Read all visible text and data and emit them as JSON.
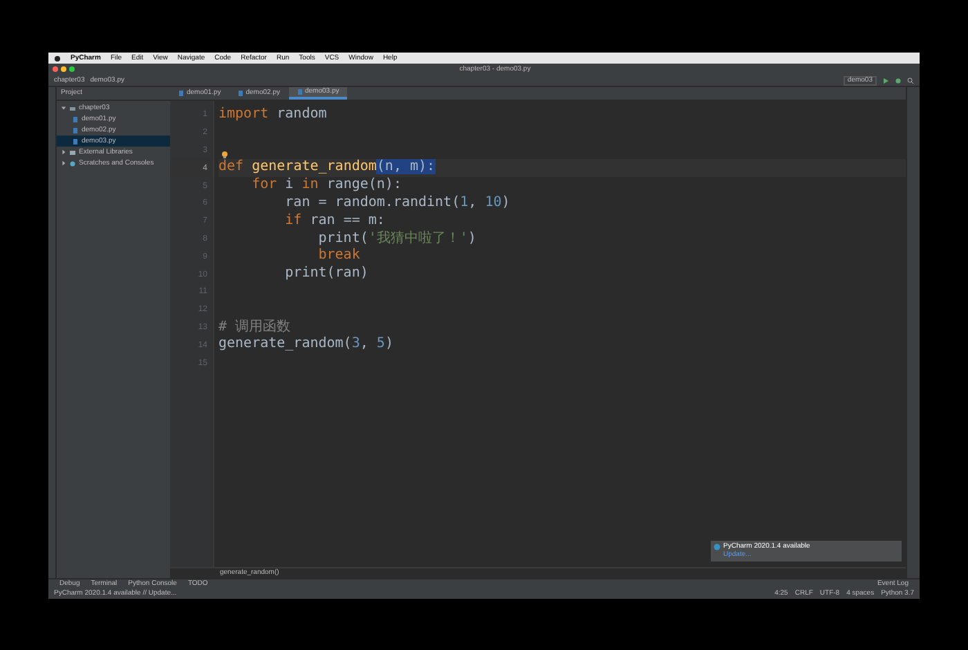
{
  "menu_bar": {
    "items": [
      "PyCharm",
      "File",
      "Edit",
      "View",
      "Navigate",
      "Code",
      "Refactor",
      "Run",
      "Tools",
      "VCS",
      "Window",
      "Help"
    ]
  },
  "window": {
    "title": "chapter03 - demo03.py"
  },
  "nav_bar": {
    "crumbs": [
      "chapter03",
      "demo03.py"
    ],
    "run_config": "demo03"
  },
  "project_panel": {
    "title": "Project",
    "tree": [
      {
        "label": "chapter03",
        "kind": "folder",
        "selected": false,
        "expanded": true,
        "children": [
          {
            "label": "demo01.py",
            "kind": "file",
            "selected": false
          },
          {
            "label": "demo02.py",
            "kind": "file",
            "selected": false
          },
          {
            "label": "demo03.py",
            "kind": "file",
            "selected": true
          }
        ]
      },
      {
        "label": "External Libraries",
        "kind": "library",
        "selected": false,
        "expanded": false
      },
      {
        "label": "Scratches and Consoles",
        "kind": "scratch",
        "selected": false,
        "expanded": false
      }
    ]
  },
  "editor_tabs": [
    {
      "label": "demo01.py",
      "selected": false
    },
    {
      "label": "demo02.py",
      "selected": false
    },
    {
      "label": "demo03.py",
      "selected": true
    }
  ],
  "code_lines": [
    {
      "number": "1",
      "current": false,
      "tokens": [
        {
          "kind": "keyword",
          "text": "import"
        },
        {
          "kind": "plain",
          "text": " random"
        }
      ]
    },
    {
      "number": "2",
      "current": false
    },
    {
      "number": "3",
      "current": false,
      "bulb": true
    },
    {
      "number": "4",
      "current": true,
      "tokens": [
        {
          "kind": "keyword",
          "text": "def "
        },
        {
          "kind": "function",
          "text": "generate_random"
        },
        {
          "kind": "highlight",
          "text": "(n, m):"
        }
      ]
    },
    {
      "number": "5",
      "current": false,
      "tokens": [
        {
          "kind": "keyword",
          "text": "    for"
        },
        {
          "kind": "plain",
          "text": " i "
        },
        {
          "kind": "keyword",
          "text": "in"
        },
        {
          "kind": "plain",
          "text": " range(n):"
        }
      ]
    },
    {
      "number": "6",
      "current": false,
      "tokens": [
        {
          "kind": "plain",
          "text": "        ran = random.randint("
        },
        {
          "kind": "number",
          "text": "1"
        },
        {
          "kind": "plain",
          "text": ", "
        },
        {
          "kind": "number",
          "text": "10"
        },
        {
          "kind": "plain",
          "text": ")"
        }
      ]
    },
    {
      "number": "7",
      "current": false,
      "tokens": [
        {
          "kind": "keyword",
          "text": "        if"
        },
        {
          "kind": "plain",
          "text": " ran == m:"
        }
      ]
    },
    {
      "number": "8",
      "current": false,
      "tokens": [
        {
          "kind": "plain",
          "text": "            print("
        },
        {
          "kind": "string",
          "text": "'我猜中啦了！'"
        },
        {
          "kind": "plain",
          "text": ")"
        }
      ]
    },
    {
      "number": "9",
      "current": false,
      "tokens": [
        {
          "kind": "keyword",
          "text": "            break"
        }
      ]
    },
    {
      "number": "10",
      "current": false,
      "tokens": [
        {
          "kind": "plain",
          "text": "        print(ran)"
        }
      ]
    },
    {
      "number": "11",
      "current": false
    },
    {
      "number": "12",
      "current": false
    },
    {
      "number": "13",
      "current": false,
      "tokens": [
        {
          "kind": "comment",
          "text": "# 调用函数"
        }
      ]
    },
    {
      "number": "14",
      "current": false,
      "tokens": [
        {
          "kind": "plain",
          "text": "generate_random("
        },
        {
          "kind": "number",
          "text": "3"
        },
        {
          "kind": "plain",
          "text": ", "
        },
        {
          "kind": "number",
          "text": "5"
        },
        {
          "kind": "plain",
          "text": ")"
        }
      ]
    },
    {
      "number": "15",
      "current": false
    }
  ],
  "editor_breadcrumb": "generate_random()",
  "notification": {
    "title": "PyCharm 2020.1.4 available",
    "link": "Update..."
  },
  "tool_tabs": [
    "Debug",
    "Terminal",
    "Python Console",
    "TODO"
  ],
  "event_log": "Event Log",
  "status_bar": {
    "message": "PyCharm 2020.1.4 available // Update...",
    "right": [
      "4:25",
      "CRLF",
      "UTF-8",
      "4 spaces",
      "Python 3.7"
    ]
  }
}
